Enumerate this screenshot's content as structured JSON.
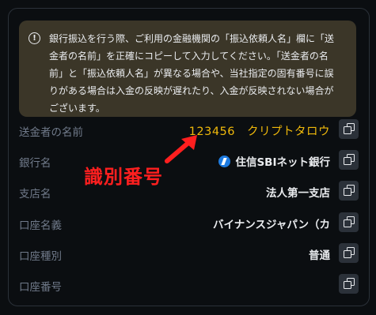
{
  "notice": {
    "lines": [
      "銀行振込を行う際、ご利用の金融機関の「振込依頼人名」欄に「送",
      "金者の名前」を正確にコピーして入力してください。「送金者の名",
      "前」と「振込依頼人名」が異なる場合や、当社指定の固有番号に誤",
      "りがある場合は入金の反映が遅れたり、入金が反映されない場合が",
      "ございます。"
    ]
  },
  "fields": {
    "sender": {
      "label": "送金者の名前",
      "value": "123456　クリプトタロウ"
    },
    "bank": {
      "label": "銀行名",
      "value": "住信SBIネット銀行"
    },
    "branch": {
      "label": "支店名",
      "value": "法人第一支店"
    },
    "account_name": {
      "label": "口座名義",
      "value": "バイナンスジャパン（カ"
    },
    "account_type": {
      "label": "口座種別",
      "value": "普通"
    },
    "account_number": {
      "label": "口座番号",
      "value": ""
    }
  },
  "annotation": {
    "text": "識別番号",
    "color": "#ff1f1f"
  },
  "colors": {
    "accent": "#f0b90b",
    "notice_bg": "#3b3628",
    "bank_logo": "#1e7be0"
  },
  "icons": {
    "info": "info-circle-icon",
    "copy": "copy-icon",
    "bank": "sbi-bank-logo-icon",
    "arrow": "red-arrow-icon"
  }
}
